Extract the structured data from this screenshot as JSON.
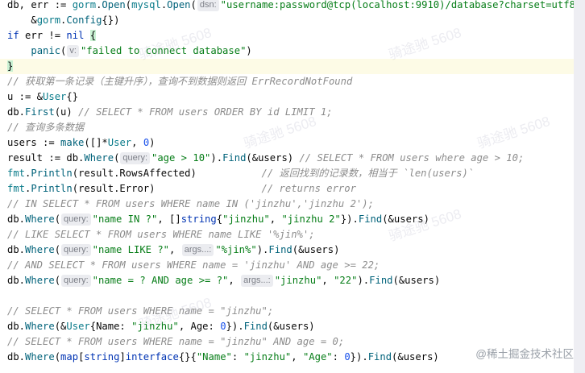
{
  "code": {
    "l1": {
      "t1": "db, err := ",
      "t2": "gorm",
      "t3": ".",
      "t4": "Open",
      "t5": "(",
      "t6": "mysql",
      "t7": ".",
      "t8": "Open",
      "t9": "(",
      "hint": "dsn:",
      "t10": "\"username:password@tcp(localhost:9910)/database?charset=utf8\"",
      "t11": ","
    },
    "l2": {
      "t1": "    &",
      "t2": "gorm",
      "t3": ".",
      "t4": "Config",
      "t5": "{})"
    },
    "l3": {
      "t1": "if",
      "t2": " err != ",
      "t3": "nil",
      "t4": " ",
      "t5": "{"
    },
    "l4": {
      "t1": "    ",
      "t2": "panic",
      "t3": "(",
      "hint": "v:",
      "t4": "\"failed to connect database\"",
      "t5": ")"
    },
    "l5": {
      "t1": "}"
    },
    "l6": {
      "t1": "// 获取第一条记录（主键升序），查询不到数据则返回 ErrRecordNotFound"
    },
    "l7": {
      "t1": "u := &",
      "t2": "User",
      "t3": "{}"
    },
    "l8": {
      "t1": "db.",
      "t2": "First",
      "t3": "(u) ",
      "t4": "// SELECT * FROM users ORDER BY id LIMIT 1;"
    },
    "l9": {
      "t1": "// 查询多条数据"
    },
    "l10": {
      "t1": "users := ",
      "t2": "make",
      "t3": "([]*",
      "t4": "User",
      "t5": ", ",
      "t6": "0",
      "t7": ")"
    },
    "l11": {
      "t1": "result := db.",
      "t2": "Where",
      "t3": "(",
      "hint": "query:",
      "t4": "\"age > 10\"",
      "t5": ").",
      "t6": "Find",
      "t7": "(&users) ",
      "t8": "// SELECT * FROM users where age > 10;"
    },
    "l12": {
      "t1": "fmt",
      "t2": ".",
      "t3": "Println",
      "t4": "(result.RowsAffected)           ",
      "t5": "// 返回找到的记录数，相当于 `len(users)`"
    },
    "l13": {
      "t1": "fmt",
      "t2": ".",
      "t3": "Println",
      "t4": "(result.Error)                  ",
      "t5": "// returns error"
    },
    "l14": {
      "t1": "// IN SELECT * FROM users WHERE name IN ('jinzhu','jinzhu 2');"
    },
    "l15": {
      "t1": "db.",
      "t2": "Where",
      "t3": "(",
      "hint": "query:",
      "t4": "\"name IN ?\"",
      "t5": ", []",
      "t6": "string",
      "t7": "{",
      "t8": "\"jinzhu\"",
      "t9": ", ",
      "t10": "\"jinzhu 2\"",
      "t11": "}).",
      "t12": "Find",
      "t13": "(&users)"
    },
    "l16": {
      "t1": "// LIKE SELECT * FROM users WHERE name LIKE '%jin%';"
    },
    "l17": {
      "t1": "db.",
      "t2": "Where",
      "t3": "(",
      "hint": "query:",
      "t4": "\"name LIKE ?\"",
      "t5": ", ",
      "hint2": "args...:",
      "t6": "\"%jin%\"",
      "t7": ").",
      "t8": "Find",
      "t9": "(&users)"
    },
    "l18": {
      "t1": "// AND SELECT * FROM users WHERE name = 'jinzhu' AND age >= 22;"
    },
    "l19": {
      "t1": "db.",
      "t2": "Where",
      "t3": "(",
      "hint": "query:",
      "t4": "\"name = ? AND age >= ?\"",
      "t5": ", ",
      "hint2": "args...:",
      "t6": "\"jinzhu\"",
      "t7": ", ",
      "t8": "\"22\"",
      "t9": ").",
      "t10": "Find",
      "t11": "(&users)"
    },
    "l20": {
      "t1": ""
    },
    "l21": {
      "t1": "// SELECT * FROM users WHERE name = \"jinzhu\";"
    },
    "l22": {
      "t1": "db.",
      "t2": "Where",
      "t3": "(&",
      "t4": "User",
      "t5": "{Name: ",
      "t6": "\"jinzhu\"",
      "t7": ", Age: ",
      "t8": "0",
      "t9": "}).",
      "t10": "Find",
      "t11": "(&users)"
    },
    "l23": {
      "t1": "// SELECT * FROM users WHERE name = \"jinzhu\" AND age = 0;"
    },
    "l24": {
      "t1": "db.",
      "t2": "Where",
      "t3": "(",
      "t4": "map",
      "t5": "[",
      "t6": "string",
      "t7": "]",
      "t8": "interface",
      "t9": "{}{",
      "t10": "\"Name\"",
      "t11": ": ",
      "t12": "\"jinzhu\"",
      "t13": ", ",
      "t14": "\"Age\"",
      "t15": ": ",
      "t16": "0",
      "t17": "}).",
      "t18": "Find",
      "t19": "(&users)"
    }
  },
  "watermark": "@稀土掘金技术社区",
  "faint_watermark": "骑途驰 5608",
  "colors": {
    "keyword": "#0033b3",
    "string": "#067d17",
    "number": "#1750eb",
    "comment": "#8c8c8c",
    "function": "#00627a"
  }
}
